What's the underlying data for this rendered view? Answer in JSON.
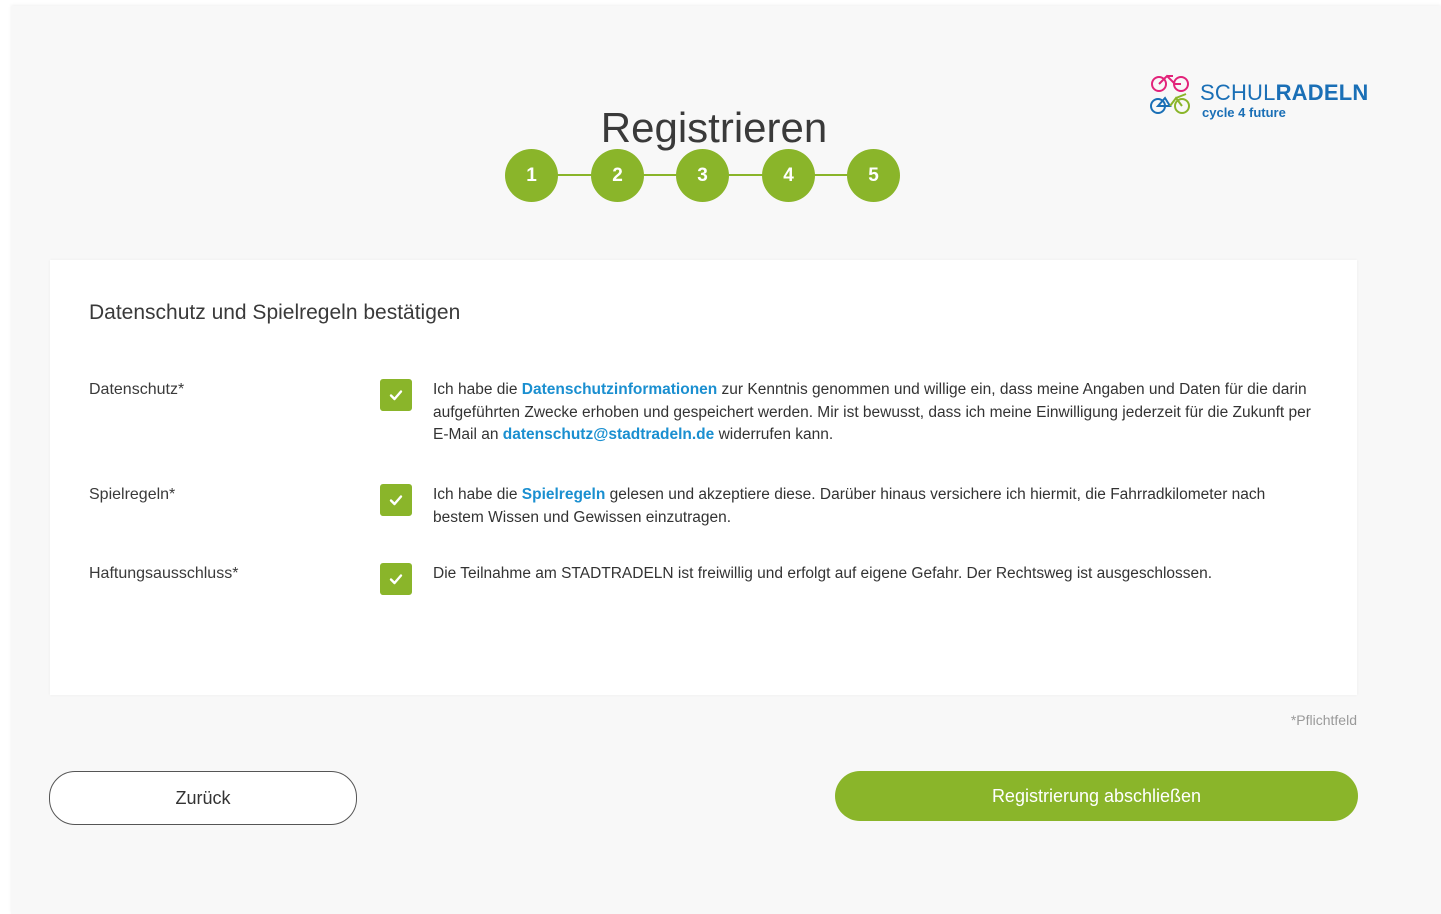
{
  "header": {
    "title": "Registrieren",
    "logo": {
      "name_light": "SCHUL",
      "name_bold": "RADELN",
      "tagline": "cycle 4 future"
    }
  },
  "steps": [
    "1",
    "2",
    "3",
    "4",
    "5"
  ],
  "colors": {
    "accent_green": "#8ab52a",
    "link_blue": "#1a8fd0",
    "logo_blue": "#1a6fb6",
    "logo_pink": "#e2237a"
  },
  "form": {
    "title": "Datenschutz und Spielregeln bestätigen",
    "rows": [
      {
        "label": "Datenschutz*",
        "checked": true,
        "text_before": "Ich habe die ",
        "link": "Datenschutzinformationen",
        "text_middle": " zur Kenntnis genommen und willige ein, dass meine Angaben und Daten für die darin aufgeführten Zwecke erhoben und gespeichert werden. Mir ist bewusst, dass ich meine Einwilligung jederzeit für die Zukunft per E-Mail an ",
        "link2": "datenschutz@stadtradeln.de",
        "text_after": " widerrufen kann."
      },
      {
        "label": "Spielregeln*",
        "checked": true,
        "text_before": "Ich habe die ",
        "link": "Spielregeln",
        "text_after": " gelesen und akzeptiere diese. Darüber hinaus versichere ich hiermit, die Fahrradkilometer nach bestem Wissen und Gewissen einzutragen."
      },
      {
        "label": "Haftungsausschluss*",
        "checked": true,
        "text": "Die Teilnahme am STADTRADELN ist freiwillig und erfolgt auf eigene Gefahr. Der Rechtsweg ist ausgeschlossen."
      }
    ],
    "required_note": "*Pflichtfeld"
  },
  "buttons": {
    "back": "Zurück",
    "submit": "Registrierung abschließen"
  },
  "icons": {
    "checkbox": "check-icon",
    "logo": "bicycle-logo-icon"
  }
}
